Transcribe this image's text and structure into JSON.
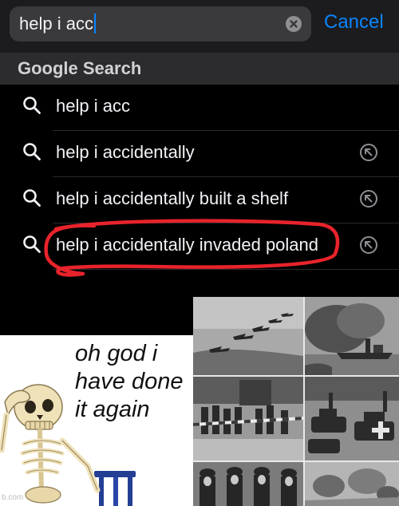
{
  "search": {
    "query": "help i acc",
    "cancel_label": "Cancel"
  },
  "suggestions": {
    "header": "Google Search",
    "items": [
      {
        "text": "help i acc",
        "has_fill_arrow": false
      },
      {
        "text": "help i accidentally",
        "has_fill_arrow": true
      },
      {
        "text": "help i accidentally built a shelf",
        "has_fill_arrow": true
      },
      {
        "text": "help i accidentally invaded poland",
        "has_fill_arrow": true,
        "circled": true
      }
    ]
  },
  "meme": {
    "caption": [
      "oh god i",
      "have done",
      "it again"
    ],
    "watermark": "b.com"
  },
  "photos": {
    "count": 6,
    "tone": "black-and-white"
  },
  "colors": {
    "accent": "#0a84ff",
    "scribble": "#e8232b",
    "background": "#000000"
  }
}
